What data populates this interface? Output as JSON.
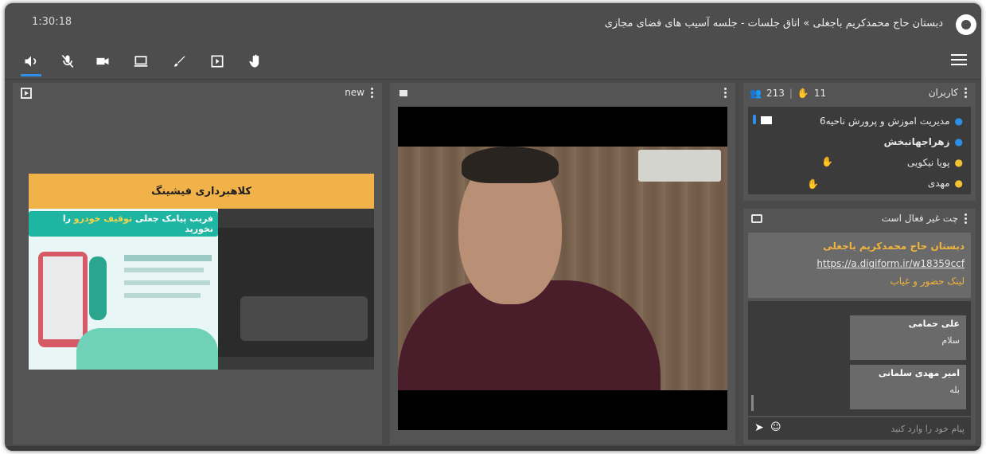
{
  "window": {
    "timestamp": "1:30:18",
    "title": "دبستان حاج محمدکریم باجغلی » اتاق جلسات - جلسه آسیب های فضای مجازی"
  },
  "toolbar": {
    "icons": [
      "speaker-icon",
      "mic-muted-icon",
      "camera-icon",
      "screen-share-icon",
      "brush-icon",
      "presentation-icon",
      "raise-hand-icon"
    ],
    "active_color": "#2f8ee8"
  },
  "presentation": {
    "label": "new",
    "slide_banner": "کلاهبرداری فیشینگ",
    "slide_headline_a": "فریب پیامک جعلی",
    "slide_headline_b": "توقیف خودرو",
    "slide_headline_c": "را نخورید"
  },
  "users": {
    "title": "کاربران",
    "total_count": "213",
    "hands_count": "11",
    "list": [
      {
        "name": "مدیریت اموزش و پرورش ناحیه6",
        "color": "blue"
      },
      {
        "name": "زهراجهانبخش",
        "color": "blue"
      },
      {
        "name": "پویا نیکویی",
        "color": "yellow"
      },
      {
        "name": "مهدی",
        "color": "yellow"
      }
    ]
  },
  "chat": {
    "title": "چت غیر فعال است",
    "notice_name": "دبستان حاج محمدکریم باجغلی",
    "notice_link": "https://a.digiform.ir/w18359ccf",
    "notice_suffix": "لینک حضور و غیاب",
    "messages": [
      {
        "sender": "علی حمامی",
        "text": "سلام"
      },
      {
        "sender": "امیر مهدی سلمانی",
        "text": "بله"
      }
    ],
    "input_placeholder": "پیام خود را وارد کنید"
  }
}
